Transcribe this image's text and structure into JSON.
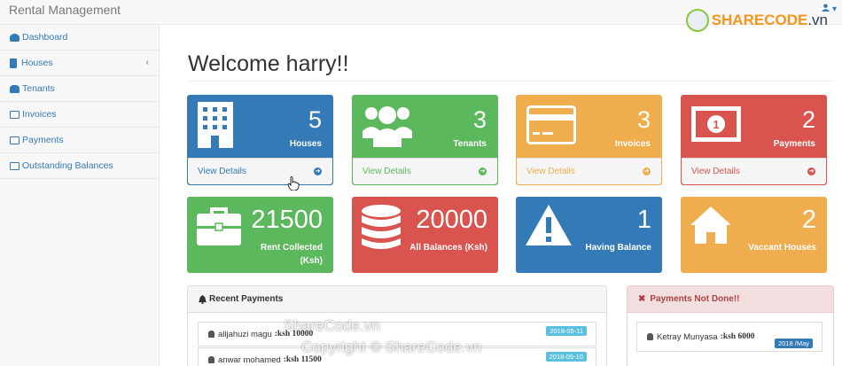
{
  "app": {
    "brand": "Rental Management"
  },
  "watermark": {
    "logo_text_main": "SHARECODE",
    "logo_text_suffix": ".vn",
    "overlay_line1": "ShareCode.vn",
    "overlay_line2": "Copyright © ShareCode.vn"
  },
  "sidebar": {
    "items": [
      {
        "label": "Dashboard",
        "icon": "dashboard-icon"
      },
      {
        "label": "Houses",
        "icon": "building-icon",
        "has_submenu": true
      },
      {
        "label": "Tenants",
        "icon": "users-icon"
      },
      {
        "label": "Invoices",
        "icon": "credit-card-icon"
      },
      {
        "label": "Payments",
        "icon": "money-icon"
      },
      {
        "label": "Outstanding Balances",
        "icon": "list-icon"
      }
    ]
  },
  "page": {
    "title": "Welcome harry!!"
  },
  "panels": [
    {
      "value": "5",
      "label": "Houses",
      "footer": "View Details",
      "color": "#337ab7",
      "icon": "building-icon"
    },
    {
      "value": "3",
      "label": "Tenants",
      "footer": "View Details",
      "color": "#5cb85c",
      "icon": "users-icon"
    },
    {
      "value": "3",
      "label": "Invoices",
      "footer": "View Details",
      "color": "#f0ad4e",
      "icon": "credit-card-icon"
    },
    {
      "value": "2",
      "label": "Payments",
      "footer": "View Details",
      "color": "#d9534f",
      "icon": "money-icon"
    }
  ],
  "stats": [
    {
      "value": "21500",
      "label_line1": "Rent Collected",
      "label_line2": "(Ksh)",
      "color": "#5cb85c",
      "icon": "briefcase-icon"
    },
    {
      "value": "20000",
      "label_line1": "All Balances (Ksh)",
      "label_line2": "",
      "color": "#d9534f",
      "icon": "database-icon"
    },
    {
      "value": "1",
      "label_line1": "Having Balance",
      "label_line2": "",
      "color": "#337ab7",
      "icon": "warning-icon"
    },
    {
      "value": "2",
      "label_line1": "Vaccant Houses",
      "label_line2": "",
      "color": "#f0ad4e",
      "icon": "home-icon"
    }
  ],
  "recent_payments": {
    "title": "Recent Payments",
    "items": [
      {
        "name": "alijahuzi magu",
        "amount": ":ksh 10000",
        "date": "2018-05-11"
      },
      {
        "name": "anwar mohamed",
        "amount": ":ksh 11500",
        "date": "2018-05-10"
      }
    ]
  },
  "payments_not_done": {
    "title": "Payments Not Done!!",
    "items": [
      {
        "name": "Ketray Munyasa",
        "amount": ":ksh 6000",
        "period": "2018 /May"
      }
    ]
  }
}
